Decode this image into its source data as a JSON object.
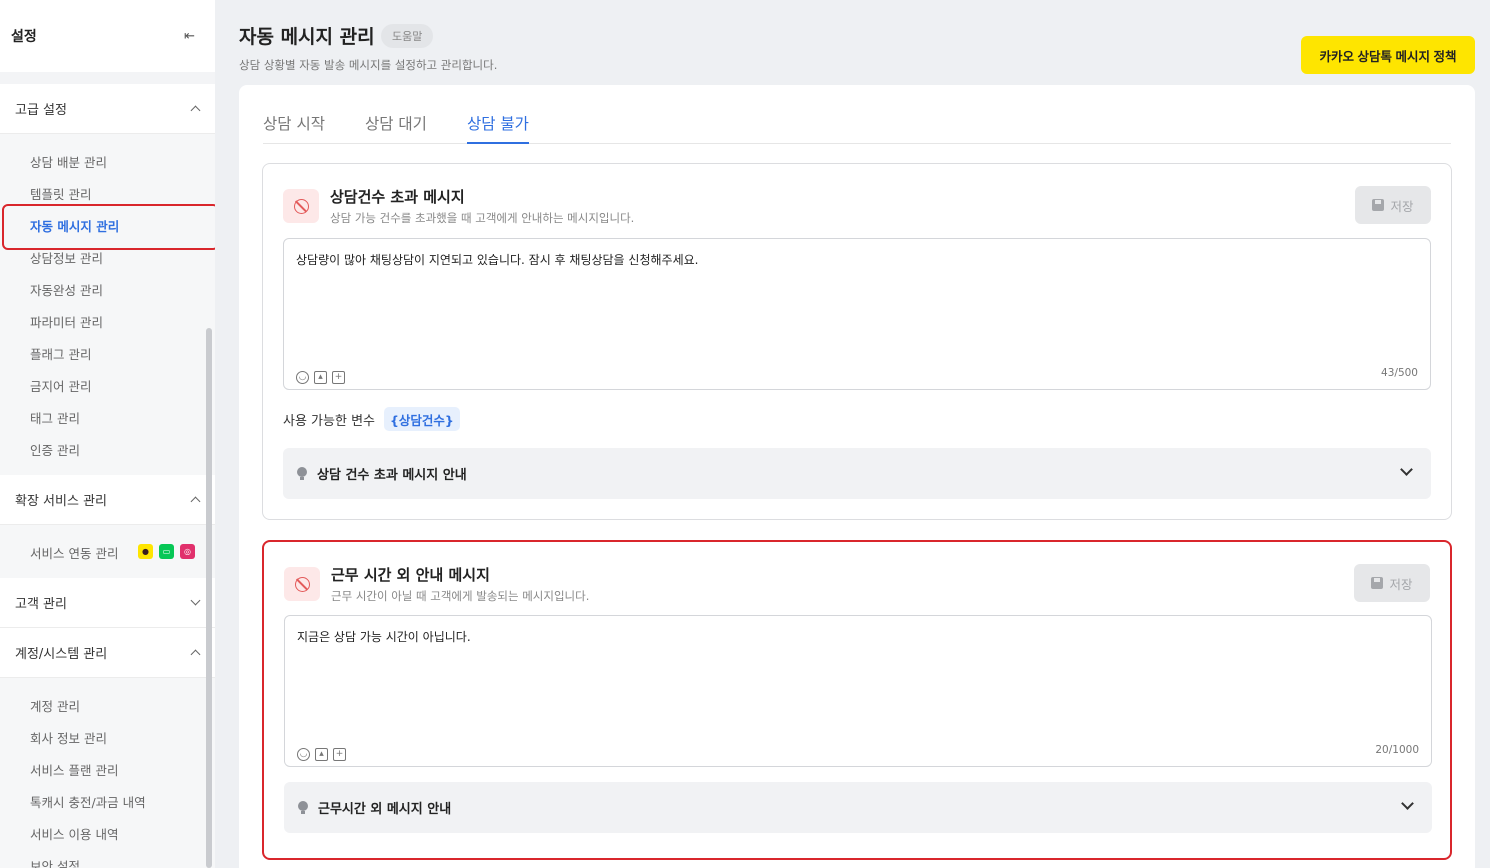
{
  "sidebar": {
    "title": "설정",
    "sections": [
      {
        "label": "고급 설정",
        "items": [
          "상담 배분 관리",
          "템플릿 관리",
          "자동 메시지 관리",
          "상담정보 관리",
          "자동완성 관리",
          "파라미터 관리",
          "플래그 관리",
          "금지어 관리",
          "태그 관리",
          "인증 관리"
        ]
      },
      {
        "label": "확장 서비스 관리",
        "items": [
          "서비스 연동 관리"
        ]
      },
      {
        "label": "고객 관리"
      },
      {
        "label": "계정/시스템 관리",
        "items": [
          "계정 관리",
          "회사 정보 관리",
          "서비스 플랜 관리",
          "톡캐시 충전/과금 내역",
          "서비스 이용 내역",
          "보안 설정"
        ]
      }
    ],
    "active_item": "자동 메시지 관리",
    "service_icon_colors": [
      "#fee500",
      "#06c755",
      "#e1306c"
    ]
  },
  "header": {
    "title": "자동 메시지 관리",
    "help_label": "도움말",
    "description": "상담 상황별 자동 발송 메시지를 설정하고 관리합니다.",
    "policy_button": "카카오 상담톡 메시지 정책"
  },
  "tabs": [
    {
      "label": "상담 시작",
      "active": false
    },
    {
      "label": "상담 대기",
      "active": false
    },
    {
      "label": "상담 불가",
      "active": true
    }
  ],
  "cards": [
    {
      "title": "상담건수 초과 메시지",
      "description": "상담 가능 건수를 초과했을 때 고객에게 안내하는 메시지입니다.",
      "save_label": "저장",
      "message": "상담량이 많아 채팅상담이 지연되고 있습니다. 잠시 후 채팅상담을 신청해주세요.",
      "counter": "43/500",
      "vars_label": "사용 가능한 변수",
      "vars": [
        "{상담건수}"
      ],
      "guide": "상담 건수 초과 메시지 안내"
    },
    {
      "title": "근무 시간 외 안내 메시지",
      "description": "근무 시간이 아닐 때 고객에게 발송되는 메시지입니다.",
      "save_label": "저장",
      "message": "지금은 상담 가능 시간이 아닙니다.",
      "counter": "20/1000",
      "guide": "근무시간 외 메시지 안내"
    }
  ],
  "colors": {
    "accent": "#2f6fe0",
    "kakao_yellow": "#fee500",
    "highlight": "#d9262c"
  }
}
